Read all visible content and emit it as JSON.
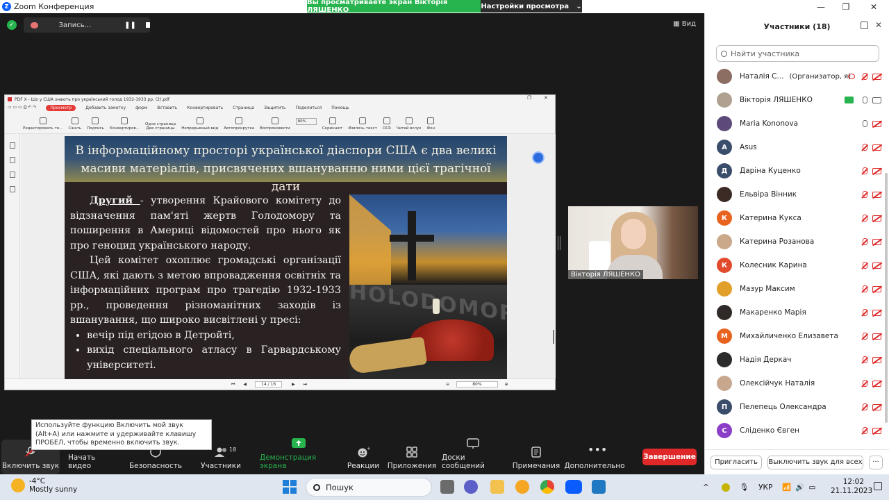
{
  "window": {
    "title": "Zoom Конференция",
    "minimize": "—",
    "maximize": "❐",
    "close": "✕"
  },
  "share_banner": {
    "viewing": "Вы просматриваете экран Вікторія ЛЯШЕНКО",
    "view_settings": "Настройки просмотра",
    "caret": "⌄"
  },
  "recording": {
    "label": "Запись...",
    "pause": "❚❚",
    "progress_ring": true
  },
  "view_button": "Вид",
  "pdf": {
    "title": "PDF X - Що у США знають про український голод 1932-1933 рр. (2).pdf",
    "menu": [
      "Просмотр",
      "Добавить заметку",
      "форм",
      "Вставить",
      "Конвертировать",
      "Страница",
      "Защитить",
      "Поделиться",
      "Помощь"
    ],
    "tools": [
      "Редактировать те...",
      "Сжать",
      "Подпись",
      "Конвертиров...",
      "Одна страница",
      "Две страницы",
      "Непрерывный вид",
      "Автопрокрутка",
      "Воспроизвести",
      "80%",
      "Скриншот",
      "Извлечь текст",
      "OCR",
      "Читай вслух",
      "Фон"
    ],
    "page_indicator": "14 / 16",
    "zoom": "80%"
  },
  "slide": {
    "header_line1": "В інформаційному просторі української діаспори США є два великі",
    "header_line2": "масиви матеріалів, присвячених вшануванню ними цієї трагічної дати",
    "lead_word": "Другий ",
    "para1": " - утворення Крайового комітету до відзначення пам'яті жертв Голодомору та поширення в Америці відомостей про нього як про геноцид українського народу.",
    "para2": "Цей комітет охоплює громадські організації США, які дають з метою впровадження освітніх та інформаційних програм про трагедію 1932-1933 рр., проведення різноманітних заходів із вшанування, що широко висвітлені у пресі:",
    "bullets": [
      "вечір під егідою  в Детройті,",
      "вихід спеціального атласу в Гарвардському університеті."
    ],
    "photo_text": "HOLODOMOR"
  },
  "video": {
    "name": "Вікторія ЛЯШЕНКО"
  },
  "participants": {
    "title": "Участники (18)",
    "search_placeholder": "Найти участника",
    "list": [
      {
        "name": "Наталія С...",
        "role": "(Организатор, я)",
        "initial": "",
        "color": "#8d6e63",
        "mic": "off",
        "cam": "off",
        "rec": true
      },
      {
        "name": "Вікторія ЛЯШЕНКО",
        "role": "",
        "initial": "",
        "color": "#b0a090",
        "mic": "on",
        "cam": "on",
        "share": true
      },
      {
        "name": "Maria Kononova",
        "role": "",
        "initial": "",
        "color": "#5d4a7a",
        "mic": "on",
        "cam": "off"
      },
      {
        "name": "Asus",
        "role": "",
        "initial": "A",
        "color": "#3a4d6b",
        "mic": "off",
        "cam": "off"
      },
      {
        "name": "Даріна Куценко",
        "role": "",
        "initial": "Д",
        "color": "#3a4d6b",
        "mic": "off",
        "cam": "off"
      },
      {
        "name": "Ельвіра Вінник",
        "role": "",
        "initial": "",
        "color": "#3b2b24",
        "mic": "off",
        "cam": "off"
      },
      {
        "name": "Катерина Кукса",
        "role": "",
        "initial": "К",
        "color": "#e8631f",
        "mic": "off",
        "cam": "off"
      },
      {
        "name": "Катерина Розанова",
        "role": "",
        "initial": "",
        "color": "#c9a98a",
        "mic": "off",
        "cam": "off"
      },
      {
        "name": "Колесник Карина",
        "role": "",
        "initial": "К",
        "color": "#e24a2d",
        "mic": "off",
        "cam": "off"
      },
      {
        "name": "Мазур Максим",
        "role": "",
        "initial": "",
        "color": "#e0a02a",
        "mic": "off",
        "cam": "off"
      },
      {
        "name": "Макаренко Марія",
        "role": "",
        "initial": "",
        "color": "#2f2a28",
        "mic": "off",
        "cam": "off"
      },
      {
        "name": "Михайличенко Елизавета",
        "role": "",
        "initial": "М",
        "color": "#e8631f",
        "mic": "off",
        "cam": "off"
      },
      {
        "name": "Надія Деркач",
        "role": "",
        "initial": "",
        "color": "#2b2b2b",
        "mic": "off",
        "cam": "off"
      },
      {
        "name": "Олексійчук Наталія",
        "role": "",
        "initial": "",
        "color": "#c8a78f",
        "mic": "off",
        "cam": "off"
      },
      {
        "name": "Пелепець Олександра",
        "role": "",
        "initial": "П",
        "color": "#3a4d6b",
        "mic": "off",
        "cam": "off"
      },
      {
        "name": "Сліденко Євген",
        "role": "",
        "initial": "С",
        "color": "#8b3fc8",
        "mic": "off",
        "cam": "off"
      }
    ],
    "invite": "Пригласить",
    "unmute_all": "Выключить звук для всех",
    "more": "···"
  },
  "toolbar": {
    "unmute": "Включить звук",
    "start_video": "Начать видео",
    "security": "Безопасность",
    "participants": "Участники",
    "participants_count": "18",
    "share": "Демонстрация экрана",
    "reactions": "Реакции",
    "apps": "Приложения",
    "whiteboards": "Доски сообщений",
    "notes": "Примечания",
    "more": "Дополнительно",
    "end": "Завершение",
    "caret": "^"
  },
  "tooltip": "Используйте функцию Включить мой звук (Alt+A) или нажмите и удерживайте клавишу ПРОБЕЛ, чтобы временно включить звук.",
  "taskbar": {
    "temp": "-4°C",
    "weather": "Mostly sunny",
    "search": "Пошук",
    "lang": "УКР",
    "time": "12:02",
    "date": "21.11.2023",
    "tray_caret": "^"
  },
  "colors": {
    "zoom_blue": "#0b5cff",
    "share_green": "#27b34d",
    "end_red": "#e02828",
    "muted_red": "#e02828"
  }
}
